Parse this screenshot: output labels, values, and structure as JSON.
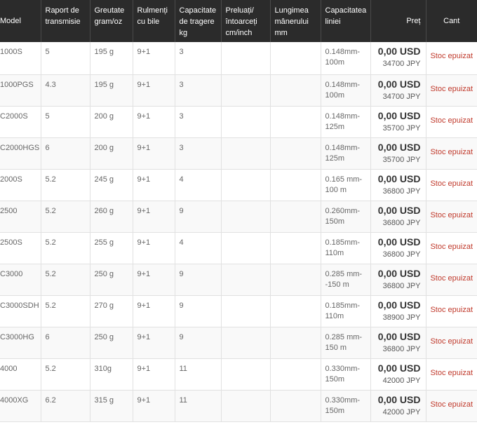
{
  "headers": {
    "model": "Model",
    "ratio": "Raport de transmisie",
    "weight": "Greutate gram/oz",
    "bearings": "Rulmenți cu bile",
    "drag": "Capacitate de tragere kg",
    "retrieve": "Preluați/ întoarceți cm/inch",
    "handle": "Lungimea mânerului mm",
    "line": "Capacitatea liniei",
    "price": "Preț",
    "qty": "Cant"
  },
  "rows": [
    {
      "model": "1000S",
      "ratio": "5",
      "weight": "195 g",
      "bearings": "9+1",
      "drag": "3",
      "retrieve": "",
      "handle": "",
      "line": "0.148mm-100m",
      "usd": "0,00 USD",
      "jpy": "34700 JPY",
      "status": "Stoc epuizat"
    },
    {
      "model": "1000PGS",
      "ratio": "4.3",
      "weight": "195 g",
      "bearings": "9+1",
      "drag": "3",
      "retrieve": "",
      "handle": "",
      "line": "0.148mm-100m",
      "usd": "0,00 USD",
      "jpy": "34700 JPY",
      "status": "Stoc epuizat"
    },
    {
      "model": "C2000S",
      "ratio": "5",
      "weight": "200 g",
      "bearings": "9+1",
      "drag": "3",
      "retrieve": "",
      "handle": "",
      "line": "0.148mm-125m",
      "usd": "0,00 USD",
      "jpy": "35700 JPY",
      "status": "Stoc epuizat"
    },
    {
      "model": "C2000HGS",
      "ratio": "6",
      "weight": "200 g",
      "bearings": "9+1",
      "drag": "3",
      "retrieve": "",
      "handle": "",
      "line": "0.148mm-125m",
      "usd": "0,00 USD",
      "jpy": "35700 JPY",
      "status": "Stoc epuizat"
    },
    {
      "model": "2000S",
      "ratio": "5.2",
      "weight": "245 g",
      "bearings": "9+1",
      "drag": "4",
      "retrieve": "",
      "handle": "",
      "line": "0.165 mm-100 m",
      "usd": "0,00 USD",
      "jpy": "36800 JPY",
      "status": "Stoc epuizat"
    },
    {
      "model": "2500",
      "ratio": "5.2",
      "weight": "260 g",
      "bearings": "9+1",
      "drag": "9",
      "retrieve": "",
      "handle": "",
      "line": "0.260mm-150m",
      "usd": "0,00 USD",
      "jpy": "36800 JPY",
      "status": "Stoc epuizat"
    },
    {
      "model": "2500S",
      "ratio": "5.2",
      "weight": "255 g",
      "bearings": "9+1",
      "drag": "4",
      "retrieve": "",
      "handle": "",
      "line": "0.185mm-110m",
      "usd": "0,00 USD",
      "jpy": "36800 JPY",
      "status": "Stoc epuizat"
    },
    {
      "model": "C3000",
      "ratio": "5.2",
      "weight": "250 g",
      "bearings": "9+1",
      "drag": "9",
      "retrieve": "",
      "handle": "",
      "line": "0.285 mm--150 m",
      "usd": "0,00 USD",
      "jpy": "36800 JPY",
      "status": "Stoc epuizat"
    },
    {
      "model": "C3000SDH",
      "ratio": "5.2",
      "weight": "270 g",
      "bearings": "9+1",
      "drag": "9",
      "retrieve": "",
      "handle": "",
      "line": "0.185mm-110m",
      "usd": "0,00 USD",
      "jpy": "38900 JPY",
      "status": "Stoc epuizat"
    },
    {
      "model": "C3000HG",
      "ratio": "6",
      "weight": "250 g",
      "bearings": "9+1",
      "drag": "9",
      "retrieve": "",
      "handle": "",
      "line": "0.285 mm-150 m",
      "usd": "0,00 USD",
      "jpy": "36800 JPY",
      "status": "Stoc epuizat"
    },
    {
      "model": "4000",
      "ratio": "5.2",
      "weight": "310g",
      "bearings": "9+1",
      "drag": "11",
      "retrieve": "",
      "handle": "",
      "line": "0.330mm-150m",
      "usd": "0,00 USD",
      "jpy": "42000 JPY",
      "status": "Stoc epuizat"
    },
    {
      "model": "4000XG",
      "ratio": "6.2",
      "weight": "315 g",
      "bearings": "9+1",
      "drag": "11",
      "retrieve": "",
      "handle": "",
      "line": "0.330mm-150m",
      "usd": "0,00 USD",
      "jpy": "42000 JPY",
      "status": "Stoc epuizat"
    }
  ]
}
